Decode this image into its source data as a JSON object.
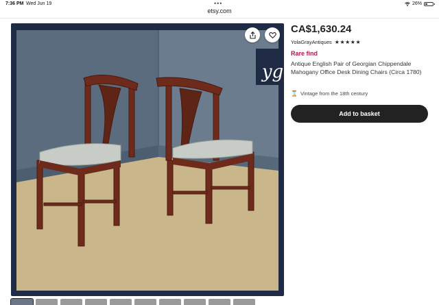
{
  "status_bar": {
    "time": "7:36 PM",
    "date": "Wed Jun 19",
    "dots": "•••",
    "battery_percent": "26%",
    "battery_level": 0.26
  },
  "browser": {
    "url": "etsy.com"
  },
  "listing": {
    "logo_text": "yg",
    "price": "CA$1,630.24",
    "shop_name": "YolaGrayAntiques",
    "rating_stars": "★★★★★",
    "rating": 5,
    "badge": "Rare find",
    "title": "Antique English Pair of Georgian Chippendale Mahogany Office Desk Dining Chairs (Circa 1780)",
    "vintage_note": "Vintage from the 18th century",
    "cta": "Add to basket",
    "icons": {
      "share": "share-icon",
      "favorite": "heart-icon",
      "vintage": "hourglass-icon"
    }
  },
  "thumbnails": [
    {
      "label": ""
    },
    {
      "label": ""
    },
    {
      "label": ""
    },
    {
      "label": ""
    },
    {
      "label": ""
    },
    {
      "label": ""
    },
    {
      "label": ""
    },
    {
      "label": ""
    },
    {
      "label": ""
    },
    {
      "label": ""
    }
  ],
  "colors": {
    "badge": "#b2174e",
    "button_bg": "#222222",
    "image_frame": "#1f2b44"
  }
}
